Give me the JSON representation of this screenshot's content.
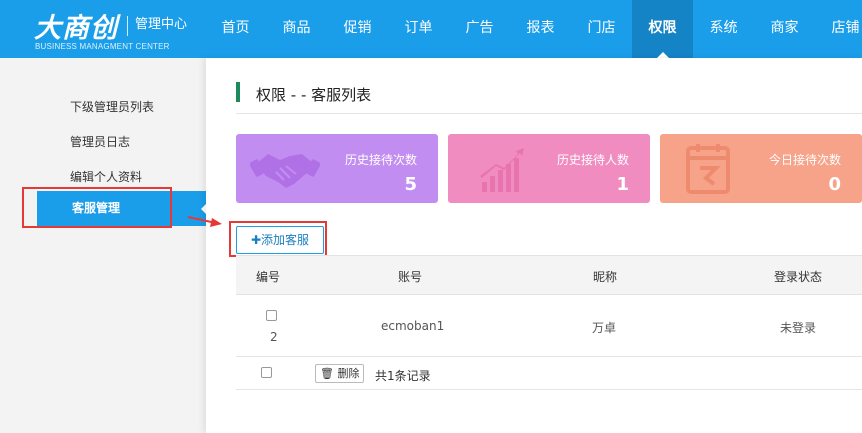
{
  "header": {
    "logo_text": "大商创",
    "logo_sub": "管理中心",
    "logo_en": "BUSINESS MANAGMENT CENTER",
    "nav": [
      {
        "label": "首页",
        "active": false
      },
      {
        "label": "商品",
        "active": false
      },
      {
        "label": "促销",
        "active": false
      },
      {
        "label": "订单",
        "active": false
      },
      {
        "label": "广告",
        "active": false
      },
      {
        "label": "报表",
        "active": false
      },
      {
        "label": "门店",
        "active": false
      },
      {
        "label": "权限",
        "active": true
      },
      {
        "label": "系统",
        "active": false
      },
      {
        "label": "商家",
        "active": false
      },
      {
        "label": "店铺",
        "active": false
      }
    ]
  },
  "sidebar": {
    "items": [
      {
        "label": "下级管理员列表"
      },
      {
        "label": "管理员日志"
      },
      {
        "label": "编辑个人资料"
      },
      {
        "label": "客服管理"
      }
    ]
  },
  "main": {
    "title": "权限 - - 客服列表",
    "cards": [
      {
        "label": "历史接待次数",
        "value": "5",
        "color": "#c28df0",
        "icon": "handshake-icon"
      },
      {
        "label": "历史接待人数",
        "value": "1",
        "color": "#f08cc0",
        "icon": "bar-growth-icon"
      },
      {
        "label": "今日接待次数",
        "value": "0",
        "color": "#f7a38a",
        "icon": "calendar-icon"
      }
    ],
    "add_button": "✚添加客服",
    "table": {
      "headers": [
        "编号",
        "账号",
        "昵称",
        "登录状态"
      ],
      "rows": [
        {
          "id": "2",
          "account": "ecmoban1",
          "nickname": "万卓",
          "status": "未登录"
        }
      ]
    },
    "delete_button": "删除",
    "total_text": "共1条记录"
  },
  "colors": {
    "accent": "#1a9eea",
    "title_bar": "#1d8a5e",
    "highlight": "#e53935"
  }
}
